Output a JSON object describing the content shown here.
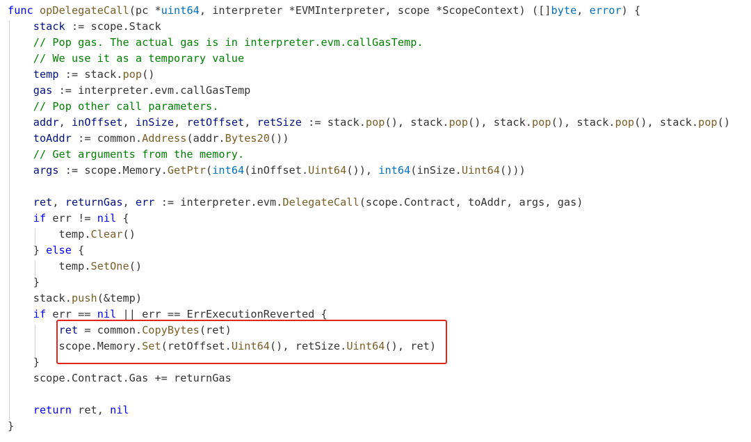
{
  "editor": {
    "theme_colors": {
      "background": "#ffffff",
      "keyword": "#0000ff",
      "type": "#0070c1",
      "variable": "#001080",
      "function": "#795e26",
      "comment": "#008000",
      "plain": "#333333",
      "highlight_box": "#e3241c"
    },
    "lines": [
      [
        [
          "kw",
          "func"
        ],
        [
          "p",
          " "
        ],
        [
          "fn",
          "opDelegateCall"
        ],
        [
          "p",
          "(pc *"
        ],
        [
          "type",
          "uint64"
        ],
        [
          "p",
          ", interpreter *EVMInterpreter, scope *ScopeContext) ([]"
        ],
        [
          "type",
          "byte"
        ],
        [
          "p",
          ", "
        ],
        [
          "type",
          "error"
        ],
        [
          "p",
          ") {"
        ]
      ],
      [
        [
          "p",
          "    "
        ],
        [
          "var",
          "stack"
        ],
        [
          "p",
          " := scope.Stack"
        ]
      ],
      [
        [
          "p",
          "    "
        ],
        [
          "cm",
          "// Pop gas. The actual gas is in interpreter.evm.callGasTemp."
        ]
      ],
      [
        [
          "p",
          "    "
        ],
        [
          "cm",
          "// We use it as a temporary value"
        ]
      ],
      [
        [
          "p",
          "    "
        ],
        [
          "var",
          "temp"
        ],
        [
          "p",
          " := stack."
        ],
        [
          "fn",
          "pop"
        ],
        [
          "p",
          "()"
        ]
      ],
      [
        [
          "p",
          "    "
        ],
        [
          "var",
          "gas"
        ],
        [
          "p",
          " := interpreter.evm.callGasTemp"
        ]
      ],
      [
        [
          "p",
          "    "
        ],
        [
          "cm",
          "// Pop other call parameters."
        ]
      ],
      [
        [
          "p",
          "    "
        ],
        [
          "var",
          "addr"
        ],
        [
          "p",
          ", "
        ],
        [
          "var",
          "inOffset"
        ],
        [
          "p",
          ", "
        ],
        [
          "var",
          "inSize"
        ],
        [
          "p",
          ", "
        ],
        [
          "var",
          "retOffset"
        ],
        [
          "p",
          ", "
        ],
        [
          "var",
          "retSize"
        ],
        [
          "p",
          " := stack."
        ],
        [
          "fn",
          "pop"
        ],
        [
          "p",
          "(), stack."
        ],
        [
          "fn",
          "pop"
        ],
        [
          "p",
          "(), stack."
        ],
        [
          "fn",
          "pop"
        ],
        [
          "p",
          "(), stack."
        ],
        [
          "fn",
          "pop"
        ],
        [
          "p",
          "(), stack."
        ],
        [
          "fn",
          "pop"
        ],
        [
          "p",
          "()"
        ]
      ],
      [
        [
          "p",
          "    "
        ],
        [
          "var",
          "toAddr"
        ],
        [
          "p",
          " := common."
        ],
        [
          "fn",
          "Address"
        ],
        [
          "p",
          "(addr."
        ],
        [
          "fn",
          "Bytes20"
        ],
        [
          "p",
          "())"
        ]
      ],
      [
        [
          "p",
          "    "
        ],
        [
          "cm",
          "// Get arguments from the memory."
        ]
      ],
      [
        [
          "p",
          "    "
        ],
        [
          "var",
          "args"
        ],
        [
          "p",
          " := scope.Memory."
        ],
        [
          "fn",
          "GetPtr"
        ],
        [
          "p",
          "("
        ],
        [
          "type",
          "int64"
        ],
        [
          "p",
          "(inOffset."
        ],
        [
          "fn",
          "Uint64"
        ],
        [
          "p",
          "()), "
        ],
        [
          "type",
          "int64"
        ],
        [
          "p",
          "(inSize."
        ],
        [
          "fn",
          "Uint64"
        ],
        [
          "p",
          "()))"
        ]
      ],
      [],
      [
        [
          "p",
          "    "
        ],
        [
          "var",
          "ret"
        ],
        [
          "p",
          ", "
        ],
        [
          "var",
          "returnGas"
        ],
        [
          "p",
          ", "
        ],
        [
          "var",
          "err"
        ],
        [
          "p",
          " := interpreter.evm."
        ],
        [
          "fn",
          "DelegateCall"
        ],
        [
          "p",
          "(scope.Contract, toAddr, args, gas)"
        ]
      ],
      [
        [
          "p",
          "    "
        ],
        [
          "kw",
          "if"
        ],
        [
          "p",
          " err != "
        ],
        [
          "kw",
          "nil"
        ],
        [
          "p",
          " {"
        ]
      ],
      [
        [
          "p",
          "        temp."
        ],
        [
          "fn",
          "Clear"
        ],
        [
          "p",
          "()"
        ]
      ],
      [
        [
          "p",
          "    } "
        ],
        [
          "kw",
          "else"
        ],
        [
          "p",
          " {"
        ]
      ],
      [
        [
          "p",
          "        temp."
        ],
        [
          "fn",
          "SetOne"
        ],
        [
          "p",
          "()"
        ]
      ],
      [
        [
          "p",
          "    }"
        ]
      ],
      [
        [
          "p",
          "    stack."
        ],
        [
          "fn",
          "push"
        ],
        [
          "p",
          "(&temp)"
        ]
      ],
      [
        [
          "p",
          "    "
        ],
        [
          "kw",
          "if"
        ],
        [
          "p",
          " err == "
        ],
        [
          "kw",
          "nil"
        ],
        [
          "p",
          " || err == ErrExecutionReverted {"
        ]
      ],
      [
        [
          "p",
          "        "
        ],
        [
          "var",
          "ret"
        ],
        [
          "p",
          " = common."
        ],
        [
          "fn",
          "CopyBytes"
        ],
        [
          "p",
          "(ret)"
        ]
      ],
      [
        [
          "p",
          "        scope.Memory."
        ],
        [
          "fn",
          "Set"
        ],
        [
          "p",
          "(retOffset."
        ],
        [
          "fn",
          "Uint64"
        ],
        [
          "p",
          "(), retSize."
        ],
        [
          "fn",
          "Uint64"
        ],
        [
          "p",
          "(), ret)"
        ]
      ],
      [
        [
          "p",
          "    }"
        ]
      ],
      [
        [
          "p",
          "    scope.Contract.Gas += returnGas"
        ]
      ],
      [],
      [
        [
          "p",
          "    "
        ],
        [
          "kw",
          "return"
        ],
        [
          "p",
          " ret, "
        ],
        [
          "kw",
          "nil"
        ]
      ],
      [
        [
          "p",
          "}"
        ]
      ]
    ]
  }
}
